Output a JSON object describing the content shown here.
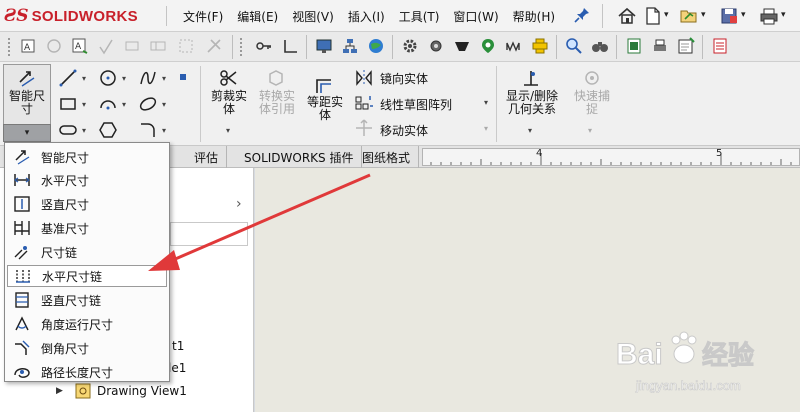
{
  "app": {
    "brand_ds": "ƧS",
    "brand_name": "SOLIDWORKS"
  },
  "menubar": {
    "items": [
      {
        "key": "file",
        "label": "文件(F)"
      },
      {
        "key": "edit",
        "label": "编辑(E)"
      },
      {
        "key": "view",
        "label": "视图(V)"
      },
      {
        "key": "insert",
        "label": "插入(I)"
      },
      {
        "key": "tools",
        "label": "工具(T)"
      },
      {
        "key": "window",
        "label": "窗口(W)"
      },
      {
        "key": "help",
        "label": "帮助(H)"
      }
    ]
  },
  "ribbon": {
    "smart_dim_label": "智能尺寸",
    "trim_label": "剪裁实体",
    "convert_label": "转换实体引用",
    "offset_label": "等距实体",
    "mirror_label": "镜向实体",
    "linear_pattern_label": "线性草图阵列",
    "move_label": "移动实体",
    "show_relations_label": "显示/删除几何关系",
    "quick_snap_label": "快速捕捉"
  },
  "tabs": {
    "evaluate": "评估",
    "addins": "SOLIDWORKS 插件",
    "sheet_format": "图纸格式"
  },
  "ruler": {
    "mark_4": "4",
    "mark_5": "5"
  },
  "tree": {
    "item1_suffix": "t1",
    "item2_suffix": "le1",
    "drawing_view": "Drawing View1"
  },
  "dropdown": {
    "items": [
      {
        "label": "智能尺寸",
        "icon": "smart-dimension-icon"
      },
      {
        "label": "水平尺寸",
        "icon": "horizontal-dimension-icon"
      },
      {
        "label": "竖直尺寸",
        "icon": "vertical-dimension-icon"
      },
      {
        "label": "基准尺寸",
        "icon": "baseline-dimension-icon"
      },
      {
        "label": "尺寸链",
        "icon": "ordinate-dimension-icon"
      },
      {
        "label": "水平尺寸链",
        "icon": "horizontal-ordinate-icon"
      },
      {
        "label": "竖直尺寸链",
        "icon": "vertical-ordinate-icon"
      },
      {
        "label": "角度运行尺寸",
        "icon": "angular-running-icon"
      },
      {
        "label": "倒角尺寸",
        "icon": "chamfer-dimension-icon"
      },
      {
        "label": "路径长度尺寸",
        "icon": "path-length-icon"
      }
    ],
    "highlighted_index": 5
  },
  "watermark": {
    "brand": "Bai",
    "brand2": "经验",
    "url": "jingyan.baidu.com"
  },
  "colors": {
    "brand_red": "#c8202a",
    "arrow_red": "#e0393a",
    "sheet_bg": "#e9e8e0"
  }
}
